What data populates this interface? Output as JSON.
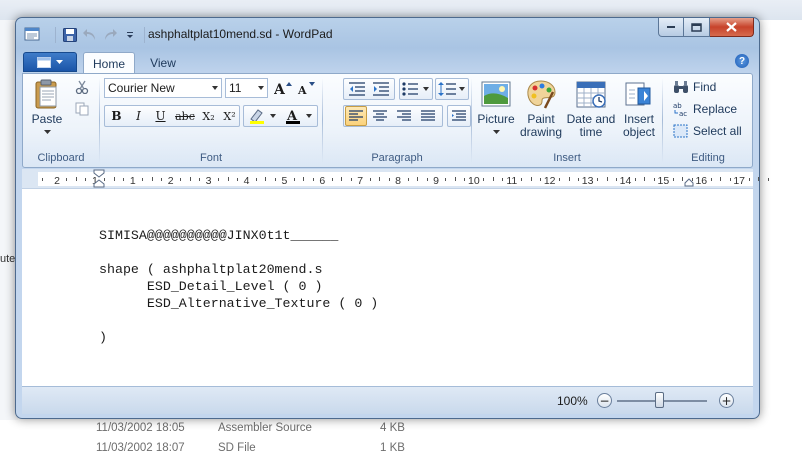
{
  "window": {
    "title": "ashphaltplat10mend.sd - WordPad"
  },
  "ribbon": {
    "tabs": [
      {
        "label": "Home"
      },
      {
        "label": "View"
      }
    ],
    "help": "?",
    "clipboard": {
      "group_label": "Clipboard",
      "paste_label": "Paste"
    },
    "font": {
      "group_label": "Font",
      "family": "Courier New",
      "size": "11",
      "bold": "B",
      "italic": "I",
      "underline": "U",
      "strike": "abc",
      "subscript": "X₂",
      "superscript": "X²",
      "color_letter": "A"
    },
    "paragraph": {
      "group_label": "Paragraph"
    },
    "insert": {
      "group_label": "Insert",
      "picture": "Picture",
      "paint_1": "Paint",
      "paint_2": "drawing",
      "date_1": "Date and",
      "date_2": "time",
      "object_1": "Insert",
      "object_2": "object"
    },
    "editing": {
      "group_label": "Editing",
      "find": "Find",
      "replace": "Replace",
      "select_all": "Select all"
    }
  },
  "ruler": {
    "numbers": [
      "2",
      "1",
      "1",
      "2",
      "3",
      "4",
      "5",
      "6",
      "7",
      "8",
      "9",
      "10",
      "11",
      "12",
      "13",
      "14",
      "15",
      "16",
      "17"
    ]
  },
  "document": {
    "lines": [
      "SIMISA@@@@@@@@@@JINX0t1t______",
      "shape ( ashphaltplat20mend.s",
      "      ESD_Detail_Level ( 0 )",
      "      ESD_Alternative_Texture ( 0 )",
      ")"
    ]
  },
  "status": {
    "zoom_text": "100%",
    "zoom_out": "−",
    "zoom_in": "+"
  },
  "background": {
    "fragments": [
      "ute"
    ],
    "rows": [
      {
        "date": "11/03/2002 18:05",
        "type": "Assembler Source",
        "size": "4 KB"
      },
      {
        "date": "11/03/2002 18:07",
        "type": "SD File",
        "size": "1 KB"
      }
    ]
  },
  "colors": {
    "ribbon_selected": "#fbd27b",
    "close_button": "#c7432b",
    "app_menu": "#1b55a8"
  }
}
